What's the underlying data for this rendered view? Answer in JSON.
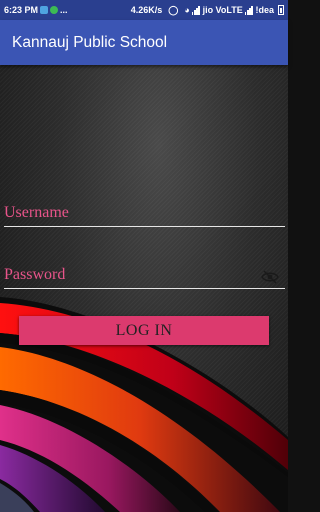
{
  "status_bar": {
    "time": "6:23 PM",
    "dots": "...",
    "speed": "4.26K/s",
    "carrier1": "jio VoLTE",
    "carrier2": "!dea"
  },
  "app_bar": {
    "title": "Kannauj Public School"
  },
  "login_form": {
    "username_label": "Username",
    "password_label": "Password",
    "login_button": "LOG IN"
  },
  "colors": {
    "status_bar": "#2a3f8f",
    "app_bar": "#3b55b4",
    "label": "#e8548a",
    "button": "#dc3a6e"
  },
  "icons": {
    "password_toggle": "eye-off-icon",
    "status": [
      "notification-icon",
      "whatsapp-icon",
      "alarm-icon",
      "wifi-icon",
      "signal-icon",
      "battery-icon"
    ]
  }
}
